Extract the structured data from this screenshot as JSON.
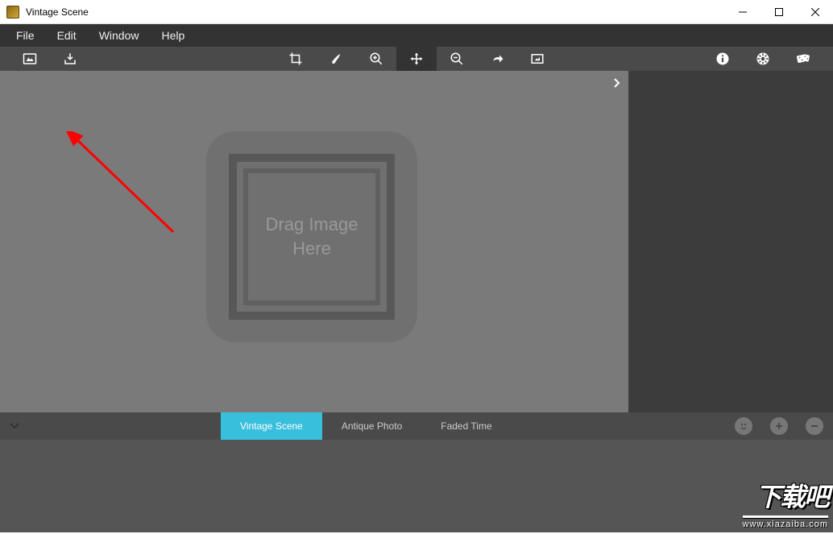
{
  "window": {
    "title": "Vintage Scene"
  },
  "menu": {
    "file": "File",
    "edit": "Edit",
    "window": "Window",
    "help": "Help"
  },
  "canvas": {
    "drop_line1": "Drag Image",
    "drop_line2": "Here"
  },
  "presets": {
    "tab1": "Vintage Scene",
    "tab2": "Antique Photo",
    "tab3": "Faded Time"
  },
  "watermark": {
    "text_main": "下载吧",
    "text_url": "www.xiazaiba.com"
  }
}
